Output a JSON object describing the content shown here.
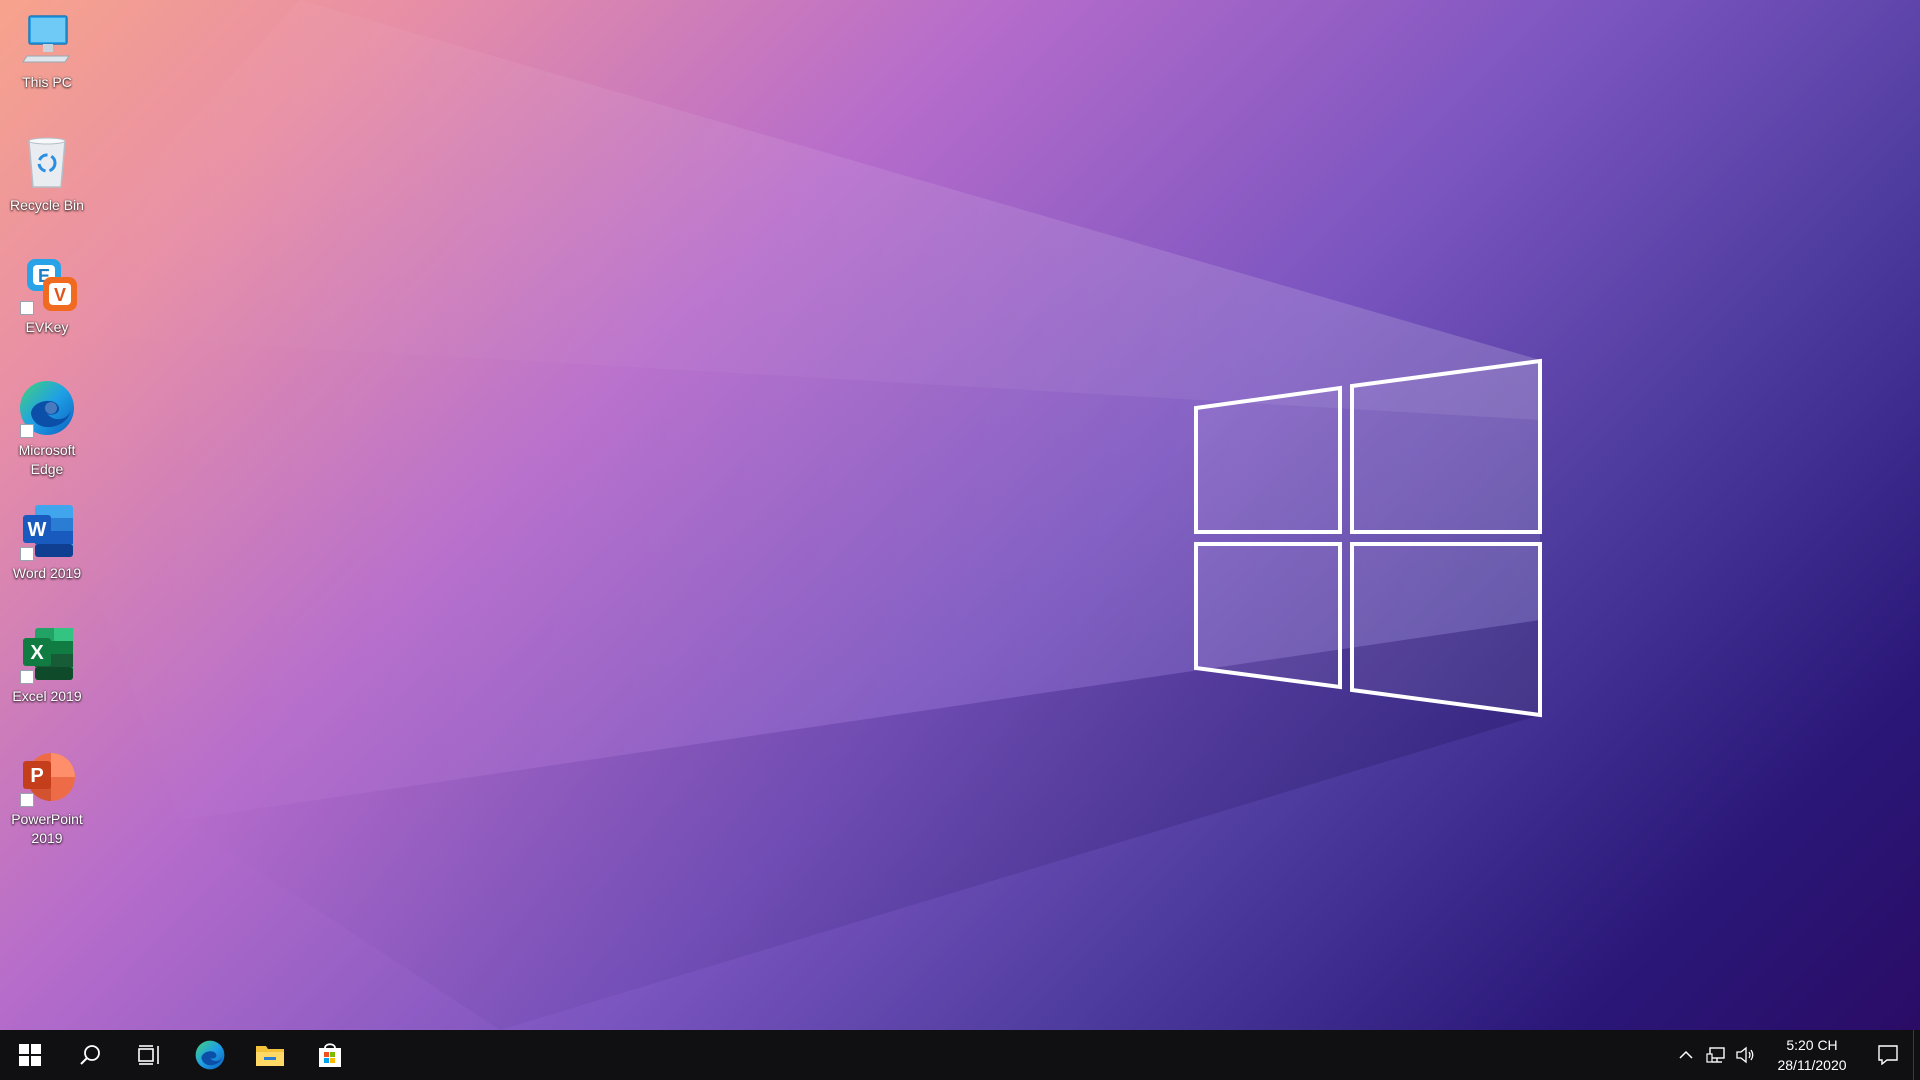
{
  "desktop": {
    "icons": [
      {
        "label": "This PC",
        "icon": "this-pc-icon"
      },
      {
        "label": "Recycle Bin",
        "icon": "recycle-bin-icon"
      },
      {
        "label": "EVKey",
        "icon": "evkey-icon"
      },
      {
        "label": "Microsoft Edge",
        "icon": "edge-icon"
      },
      {
        "label": "Word 2019",
        "icon": "word-icon"
      },
      {
        "label": "Excel 2019",
        "icon": "excel-icon"
      },
      {
        "label": "PowerPoint 2019",
        "icon": "powerpoint-icon"
      }
    ]
  },
  "taskbar": {
    "buttons": [
      {
        "icon": "start-windows-icon"
      },
      {
        "icon": "search-icon"
      },
      {
        "icon": "task-view-icon"
      },
      {
        "icon": "edge-icon"
      },
      {
        "icon": "file-explorer-icon"
      },
      {
        "icon": "microsoft-store-icon"
      }
    ],
    "tray": {
      "icons": [
        "chevron-up-icon",
        "network-icon",
        "volume-icon"
      ],
      "time": "5:20 CH",
      "date": "28/11/2020"
    }
  },
  "colors": {
    "taskbar": "#101012",
    "accent_edge": "#1fa0e6",
    "word": "#2b5cbf",
    "excel": "#1d7044",
    "powerpoint": "#d24726"
  }
}
